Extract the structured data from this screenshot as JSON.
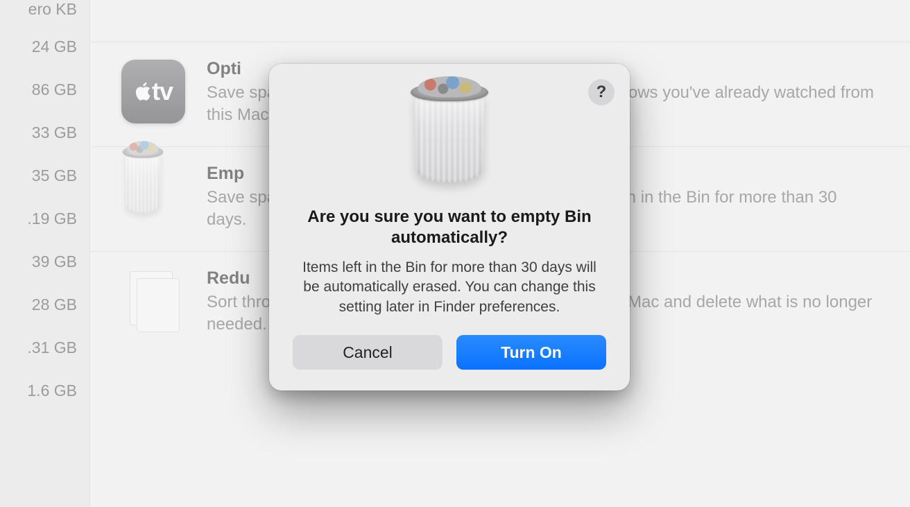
{
  "sidebar": {
    "sizes": [
      "ero KB",
      "24 GB",
      "86 GB",
      "33 GB",
      "35 GB",
      ".19 GB",
      "39 GB",
      "28 GB",
      ".31 GB",
      "1.6 GB"
    ]
  },
  "sections": {
    "optimise": {
      "title": "Opti",
      "body": "Save space by automatically removing movies and TV shows you've already watched from this Mac."
    },
    "empty": {
      "title": "Emp",
      "body": "Save space by automatically erasing items that have been in the Bin for more than 30 days."
    },
    "reduce": {
      "title": "Redu",
      "body": "Sort through documents and other content stored on this Mac and delete what is no longer needed."
    }
  },
  "dialog": {
    "help_label": "?",
    "title": "Are you sure you want to empty Bin automatically?",
    "description": "Items left in the Bin for more than 30 days will be automatically erased. You can change this setting later in Finder preferences.",
    "cancel_label": "Cancel",
    "confirm_label": "Turn On"
  },
  "icons": {
    "tv_text": "tv"
  }
}
